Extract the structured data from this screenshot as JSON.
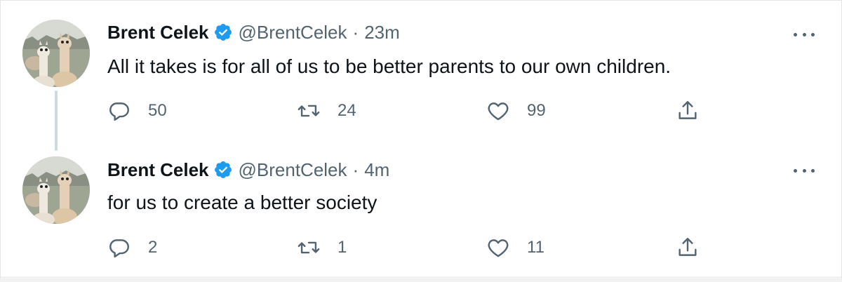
{
  "colors": {
    "verified": "#1d9bf0",
    "muted": "#536471",
    "text": "#0f1419",
    "thread_line": "#cfd9de"
  },
  "tweets": [
    {
      "author_name": "Brent Celek",
      "handle": "@BrentCelek",
      "separator": "·",
      "time": "23m",
      "text": "All it takes is for all of us to be better parents to our own children.",
      "replies": "50",
      "retweets": "24",
      "likes": "99",
      "icons": [
        "avatar-alpacas",
        "verified-badge-icon",
        "more-icon",
        "reply-icon",
        "retweet-icon",
        "like-icon",
        "share-icon"
      ]
    },
    {
      "author_name": "Brent Celek",
      "handle": "@BrentCelek",
      "separator": "·",
      "time": "4m",
      "text": "for us to create a better society",
      "replies": "2",
      "retweets": "1",
      "likes": "11",
      "icons": [
        "avatar-alpacas",
        "verified-badge-icon",
        "more-icon",
        "reply-icon",
        "retweet-icon",
        "like-icon",
        "share-icon"
      ]
    }
  ]
}
